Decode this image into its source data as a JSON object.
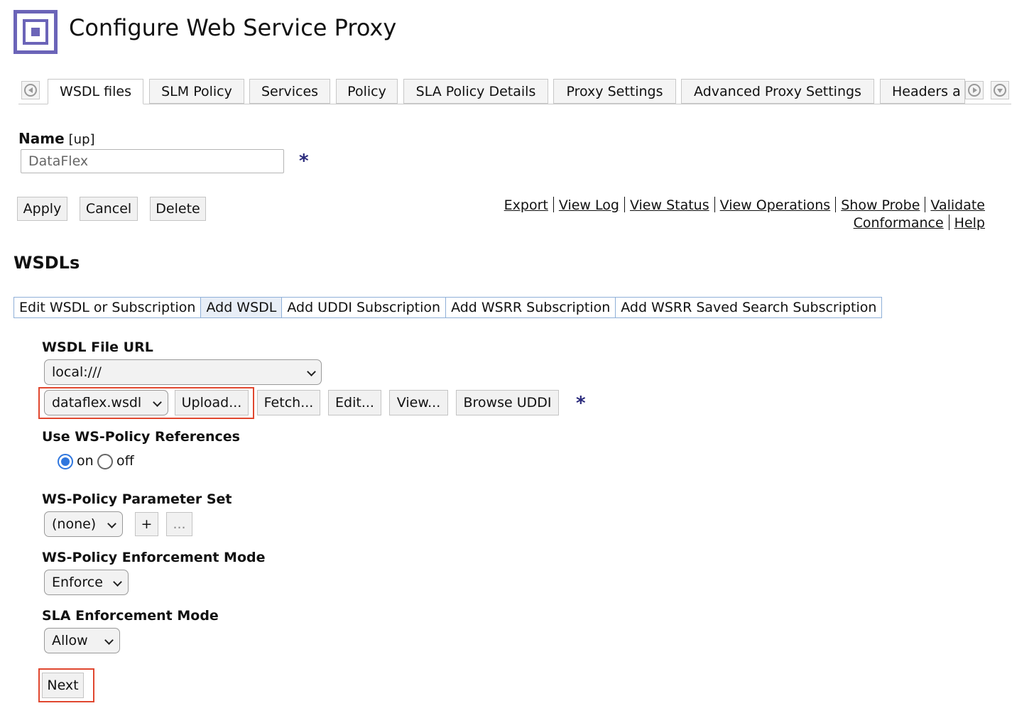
{
  "header": {
    "title": "Configure Web Service Proxy",
    "logo_icon": "square-in-square-icon",
    "accent_color": "#6b64b8"
  },
  "tabs": {
    "items": [
      {
        "label": "WSDL files",
        "active": true
      },
      {
        "label": "SLM Policy",
        "active": false
      },
      {
        "label": "Services",
        "active": false
      },
      {
        "label": "Policy",
        "active": false
      },
      {
        "label": "SLA Policy Details",
        "active": false
      },
      {
        "label": "Proxy Settings",
        "active": false
      },
      {
        "label": "Advanced Proxy Settings",
        "active": false
      },
      {
        "label": "Headers a",
        "active": false
      }
    ]
  },
  "name_field": {
    "label": "Name",
    "hint": "[up]",
    "value": "DataFlex",
    "required_marker": "*"
  },
  "actions": {
    "apply": "Apply",
    "cancel": "Cancel",
    "delete": "Delete"
  },
  "links": {
    "export": "Export",
    "view_log": "View Log",
    "view_status": "View Status",
    "view_operations": "View Operations",
    "show_probe": "Show Probe",
    "validate": "Validate",
    "conformance": "Conformance",
    "help": "Help"
  },
  "wsdls": {
    "title": "WSDLs",
    "subtabs": [
      {
        "label": "Edit WSDL or Subscription",
        "active": false
      },
      {
        "label": "Add WSDL",
        "active": true
      },
      {
        "label": "Add UDDI Subscription",
        "active": false
      },
      {
        "label": "Add WSRR Subscription",
        "active": false
      },
      {
        "label": "Add WSRR Saved Search Subscription",
        "active": false
      }
    ],
    "file_url": {
      "label": "WSDL File URL",
      "scheme": "local:///",
      "file": "dataflex.wsdl",
      "upload": "Upload...",
      "fetch": "Fetch...",
      "edit": "Edit...",
      "view": "View...",
      "browse_uddi": "Browse UDDI",
      "required_marker": "*"
    },
    "ws_policy_refs": {
      "label": "Use WS-Policy References",
      "on": "on",
      "off": "off",
      "selected": "on"
    },
    "param_set": {
      "label": "WS-Policy Parameter Set",
      "value": "(none)",
      "add": "+",
      "more": "..."
    },
    "enforcement_mode": {
      "label": "WS-Policy Enforcement Mode",
      "value": "Enforce"
    },
    "sla_mode": {
      "label": "SLA Enforcement Mode",
      "value": "Allow"
    },
    "next": "Next"
  },
  "colors": {
    "highlight_box": "#e0472f",
    "radio_selected": "#2f76de",
    "subtab_border": "#8fb0d8",
    "required_marker": "#2a2a7c"
  }
}
